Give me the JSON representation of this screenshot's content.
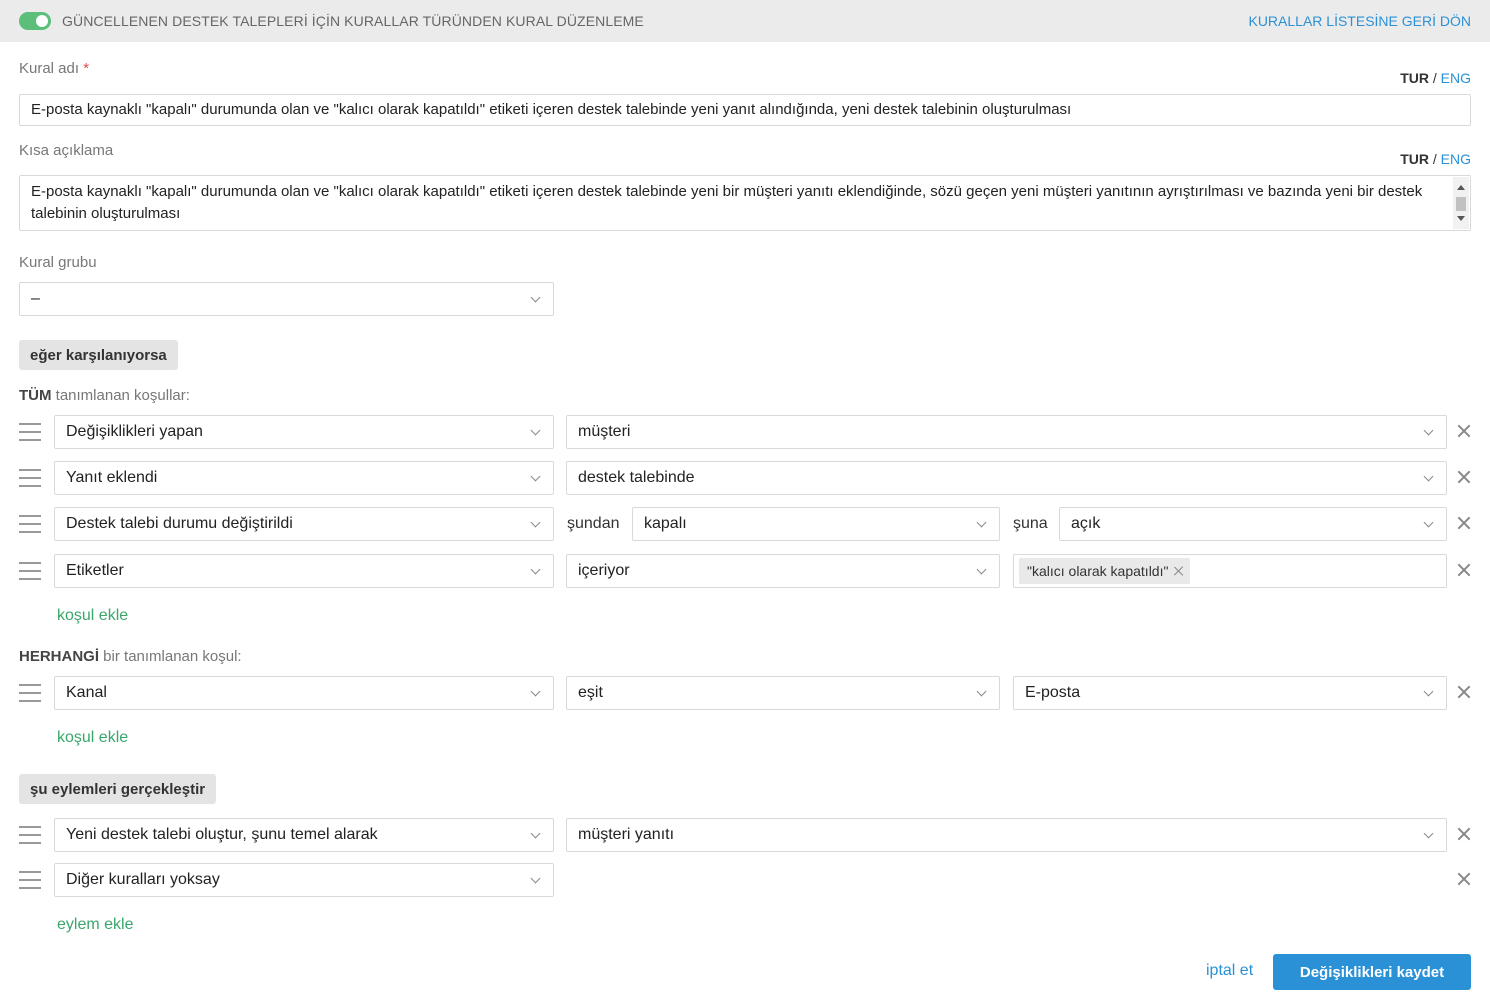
{
  "header": {
    "title": "GÜNCELLENEN DESTEK TALEPLERİ İÇİN KURALLAR TÜRÜNDEN KURAL DÜZENLEME",
    "back_link": "KURALLAR LİSTESİNE GERİ DÖN",
    "toggle_on": true
  },
  "lang": {
    "tur": "TUR",
    "sep": "/",
    "eng": "ENG"
  },
  "rule_name": {
    "label": "Kural adı",
    "required_mark": "*",
    "value": "E-posta kaynaklı \"kapalı\" durumunda olan ve \"kalıcı olarak kapatıldı\" etiketi içeren destek talebinde yeni yanıt alındığında, yeni destek talebinin oluşturulması"
  },
  "short_desc": {
    "label": "Kısa açıklama",
    "value": "E-posta kaynaklı \"kapalı\" durumunda olan ve \"kalıcı olarak kapatıldı\" etiketi içeren destek talebinde yeni bir müşteri yanıtı eklendiğinde, sözü geçen yeni müşteri yanıtının ayrıştırılması ve bazında yeni bir destek talebinin oluşturulması"
  },
  "rule_group": {
    "label": "Kural grubu",
    "value": "–"
  },
  "if_section": {
    "label": "eğer karşılanıyorsa"
  },
  "all_conditions": {
    "label_strong": "TÜM",
    "label_rest": " tanımlanan koşullar:",
    "rows": [
      {
        "field": "Değişiklikleri yapan",
        "value": "müşteri"
      },
      {
        "field": "Yanıt eklendi",
        "value": "destek talebinde"
      },
      {
        "field": "Destek talebi durumu değiştirildi",
        "from_word": "şundan",
        "from": "kapalı",
        "to_word": "şuna",
        "to": "açık"
      },
      {
        "field": "Etiketler",
        "operator": "içeriyor",
        "tag": "\"kalıcı olarak kapatıldı\""
      }
    ],
    "add_label": "koşul ekle"
  },
  "any_conditions": {
    "label_strong": "HERHANGİ",
    "label_rest": " bir tanımlanan koşul:",
    "rows": [
      {
        "field": "Kanal",
        "operator": "eşit",
        "value": "E-posta"
      }
    ],
    "add_label": "koşul ekle"
  },
  "actions_section": {
    "label": "şu eylemleri gerçekleştir"
  },
  "actions": {
    "rows": [
      {
        "field": "Yeni destek talebi oluştur, şunu temel alarak",
        "value": "müşteri yanıtı"
      },
      {
        "field": "Diğer kuralları yoksay"
      }
    ],
    "add_label": "eylem ekle"
  },
  "footer": {
    "cancel": "iptal et",
    "save": "Değişiklikleri kaydet"
  },
  "colors": {
    "accent": "#2b91d6",
    "green": "#3aa66b",
    "toggle": "#5bbf7a",
    "required": "#e04848"
  }
}
